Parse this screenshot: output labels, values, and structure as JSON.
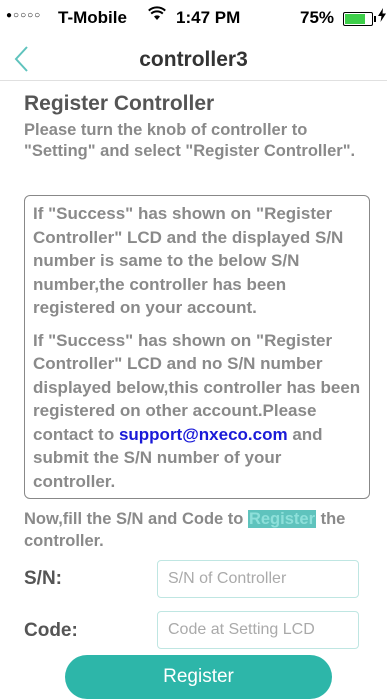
{
  "status_bar": {
    "signal": "●○○○○",
    "carrier": "T-Mobile",
    "wifi": "⌔",
    "time": "1:47 PM",
    "battery": "75%",
    "charge": "⚡"
  },
  "nav": {
    "title": "controller3"
  },
  "main": {
    "heading": "Register Controller",
    "instructions": "Please turn the knob of controller to \"Setting\" and select \"Register Controller\".",
    "info_para_1": "If \"Success\" has shown on \"Register Controller\" LCD and the displayed S/N number is same to the below S/N number,the controller has been registered on your account.",
    "info_para_2_before": "If \"Success\" has shown on \"Register Controller\" LCD and no S/N number displayed below,this controller has been registered on other account.Please contact to ",
    "support_email": "support@nxeco.com",
    "info_para_2_after": " and submit the S/N number of your controller.",
    "fill_before": "Now,fill the S/N and Code to ",
    "fill_link": "Register",
    "fill_after": " the controller."
  },
  "form": {
    "sn_label": "S/N:",
    "sn_placeholder": "S/N of Controller",
    "code_label": "Code:",
    "code_placeholder": "Code at Setting LCD",
    "submit_label": "Register"
  },
  "colors": {
    "accent": "#2db6a9",
    "link": "#1a1ad8",
    "muted_text": "#8a8a8a"
  }
}
